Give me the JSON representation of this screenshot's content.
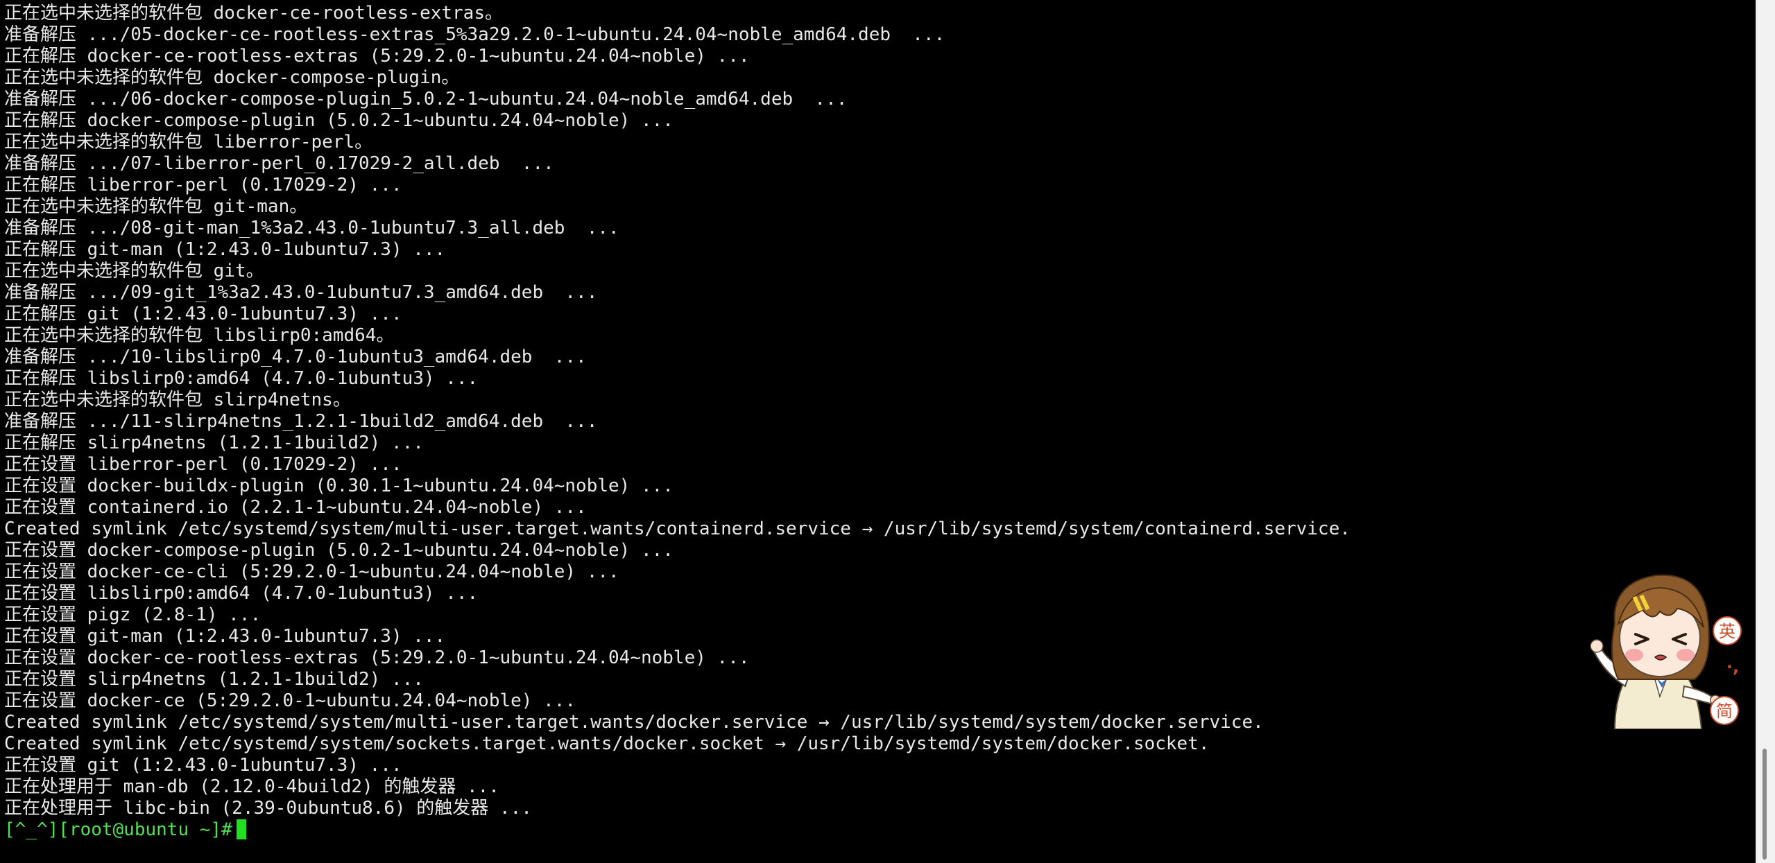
{
  "terminal": {
    "lines": [
      "正在选中未选择的软件包 docker-ce-rootless-extras。",
      "准备解压 .../05-docker-ce-rootless-extras_5%3a29.2.0-1~ubuntu.24.04~noble_amd64.deb  ...",
      "正在解压 docker-ce-rootless-extras (5:29.2.0-1~ubuntu.24.04~noble) ...",
      "正在选中未选择的软件包 docker-compose-plugin。",
      "准备解压 .../06-docker-compose-plugin_5.0.2-1~ubuntu.24.04~noble_amd64.deb  ...",
      "正在解压 docker-compose-plugin (5.0.2-1~ubuntu.24.04~noble) ...",
      "正在选中未选择的软件包 liberror-perl。",
      "准备解压 .../07-liberror-perl_0.17029-2_all.deb  ...",
      "正在解压 liberror-perl (0.17029-2) ...",
      "正在选中未选择的软件包 git-man。",
      "准备解压 .../08-git-man_1%3a2.43.0-1ubuntu7.3_all.deb  ...",
      "正在解压 git-man (1:2.43.0-1ubuntu7.3) ...",
      "正在选中未选择的软件包 git。",
      "准备解压 .../09-git_1%3a2.43.0-1ubuntu7.3_amd64.deb  ...",
      "正在解压 git (1:2.43.0-1ubuntu7.3) ...",
      "正在选中未选择的软件包 libslirp0:amd64。",
      "准备解压 .../10-libslirp0_4.7.0-1ubuntu3_amd64.deb  ...",
      "正在解压 libslirp0:amd64 (4.7.0-1ubuntu3) ...",
      "正在选中未选择的软件包 slirp4netns。",
      "准备解压 .../11-slirp4netns_1.2.1-1build2_amd64.deb  ...",
      "正在解压 slirp4netns (1.2.1-1build2) ...",
      "正在设置 liberror-perl (0.17029-2) ...",
      "正在设置 docker-buildx-plugin (0.30.1-1~ubuntu.24.04~noble) ...",
      "正在设置 containerd.io (2.2.1-1~ubuntu.24.04~noble) ...",
      "Created symlink /etc/systemd/system/multi-user.target.wants/containerd.service → /usr/lib/systemd/system/containerd.service.",
      "正在设置 docker-compose-plugin (5.0.2-1~ubuntu.24.04~noble) ...",
      "正在设置 docker-ce-cli (5:29.2.0-1~ubuntu.24.04~noble) ...",
      "正在设置 libslirp0:amd64 (4.7.0-1ubuntu3) ...",
      "正在设置 pigz (2.8-1) ...",
      "正在设置 git-man (1:2.43.0-1ubuntu7.3) ...",
      "正在设置 docker-ce-rootless-extras (5:29.2.0-1~ubuntu.24.04~noble) ...",
      "正在设置 slirp4netns (1.2.1-1build2) ...",
      "正在设置 docker-ce (5:29.2.0-1~ubuntu.24.04~noble) ...",
      "Created symlink /etc/systemd/system/multi-user.target.wants/docker.service → /usr/lib/systemd/system/docker.service.",
      "Created symlink /etc/systemd/system/sockets.target.wants/docker.socket → /usr/lib/systemd/system/docker.socket.",
      "正在设置 git (1:2.43.0-1ubuntu7.3) ...",
      "正在处理用于 man-db (2.12.0-4build2) 的触发器 ...",
      "正在处理用于 libc-bin (2.39-0ubuntu8.6) 的触发器 ..."
    ],
    "prompt": "[^_^][root@ubuntu ~]#"
  },
  "ime": {
    "mode_label": "英",
    "separator": "·,",
    "script_label": "简",
    "icon": "ime-mascot-icon"
  },
  "colors": {
    "background": "#000000",
    "text": "#e8e8e8",
    "prompt": "#52e052",
    "cursor": "#22dd22"
  }
}
